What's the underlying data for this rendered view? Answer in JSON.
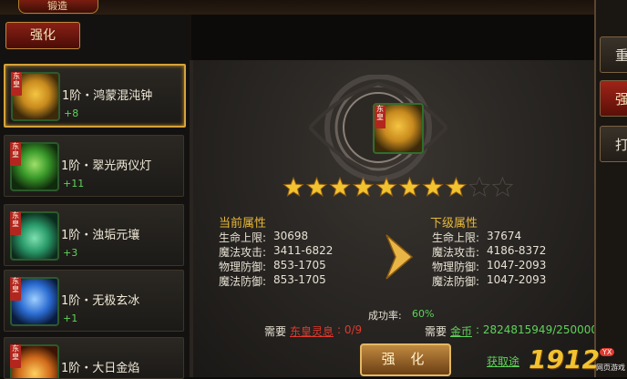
{
  "window": {
    "title": "锻造"
  },
  "tabs": {
    "strengthen": "强化"
  },
  "items": [
    {
      "tag": "东皇",
      "name": "1阶・鸿蒙混沌钟",
      "level": "+8",
      "color": "#c88a1e",
      "icon": "bell-icon"
    },
    {
      "tag": "东皇",
      "name": "1阶・翠光两仪灯",
      "level": "+11",
      "color": "#3a9a2a",
      "icon": "lamp-icon"
    },
    {
      "tag": "东皇",
      "name": "1阶・浊垢元壤",
      "level": "+3",
      "color": "#2a9a6a",
      "icon": "earth-icon"
    },
    {
      "tag": "东皇",
      "name": "1阶・无极玄冰",
      "level": "+1",
      "color": "#2a6ad0",
      "icon": "ice-crystal-icon"
    },
    {
      "tag": "东皇",
      "name": "1阶・大日金焰",
      "level": "",
      "color": "#d06a1a",
      "icon": "flame-icon"
    }
  ],
  "main_item": {
    "tag": "东皇",
    "icon": "bell-icon"
  },
  "stars": {
    "filled": 8,
    "total": 10
  },
  "current": {
    "header": "当前属性",
    "rows": [
      {
        "label": "生命上限:",
        "value": "30698"
      },
      {
        "label": "魔法攻击:",
        "value": "3411-6822"
      },
      {
        "label": "物理防御:",
        "value": "853-1705"
      },
      {
        "label": "魔法防御:",
        "value": "853-1705"
      }
    ]
  },
  "next": {
    "header": "下级属性",
    "rows": [
      {
        "label": "生命上限:",
        "value": "37674"
      },
      {
        "label": "魔法攻击:",
        "value": "4186-8372"
      },
      {
        "label": "物理防御:",
        "value": "1047-2093"
      },
      {
        "label": "魔法防御:",
        "value": "1047-2093"
      }
    ]
  },
  "success": {
    "label": "成功率:",
    "value": "60%"
  },
  "requirements": {
    "need1_prefix": "需要",
    "need1_item": "东皇灵息",
    "need1_count": ": 0/9",
    "need2_prefix": "需要",
    "need2_item": "金币",
    "need2_count": ": 2824815949/250000"
  },
  "actions": {
    "strengthen_button": "强 化",
    "obtain_link": "获取途"
  },
  "right_tabs": [
    "重",
    "强",
    "打"
  ],
  "logo": {
    "text": "1912",
    "badge": "YX",
    "sub": "网页游戏"
  },
  "colors": {
    "gold": "#e8b93a",
    "green": "#5fd35a",
    "red": "#e03a2e"
  }
}
